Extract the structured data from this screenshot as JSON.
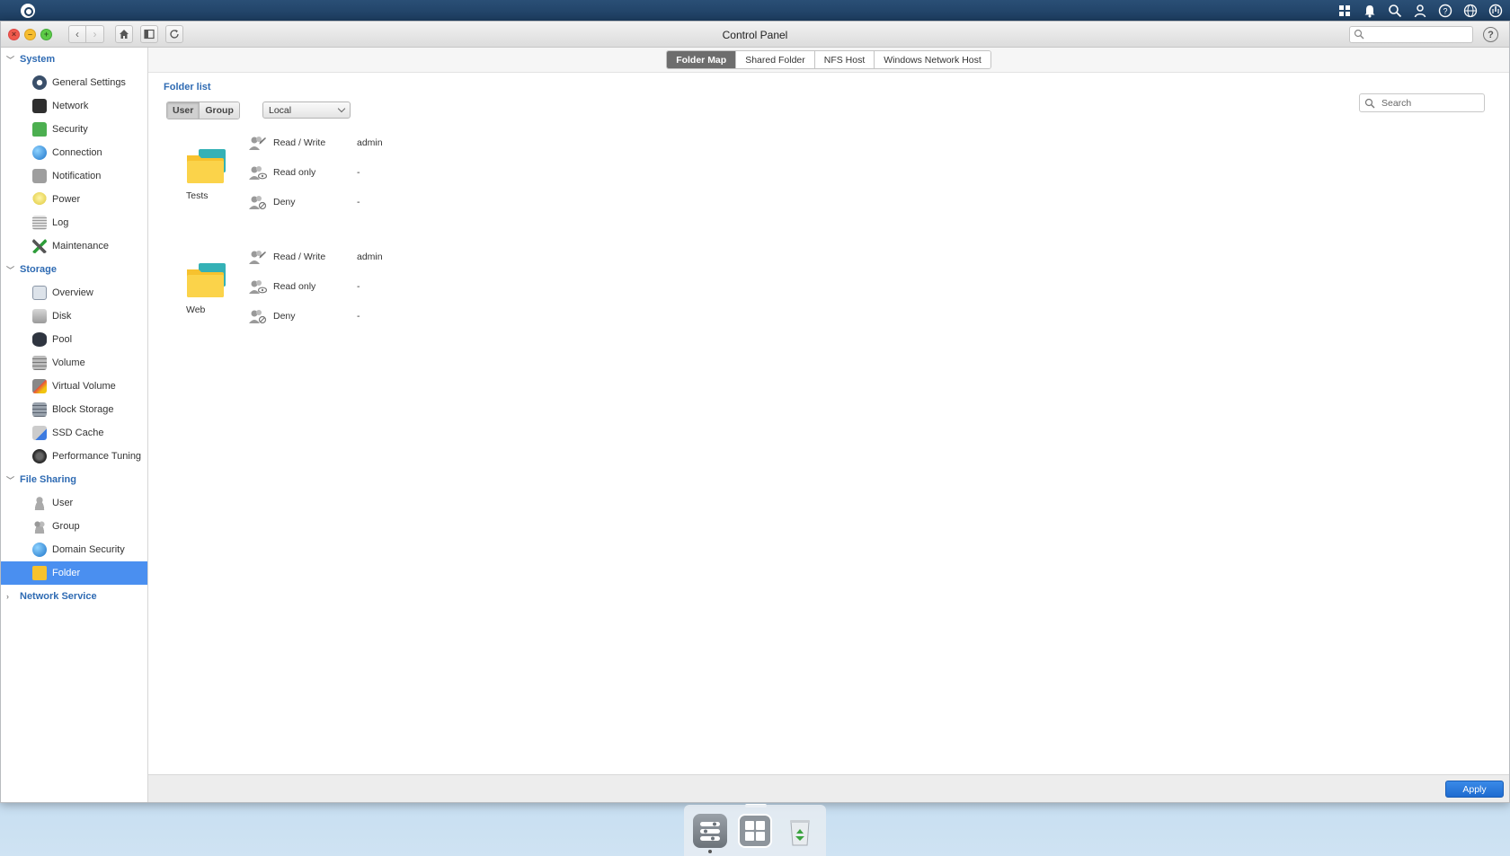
{
  "window": {
    "title": "Control Panel"
  },
  "sidebar": {
    "sections": [
      {
        "label": "System",
        "items": [
          "General Settings",
          "Network",
          "Security",
          "Connection",
          "Notification",
          "Power",
          "Log",
          "Maintenance"
        ]
      },
      {
        "label": "Storage",
        "items": [
          "Overview",
          "Disk",
          "Pool",
          "Volume",
          "Virtual Volume",
          "Block Storage",
          "SSD Cache",
          "Performance Tuning"
        ]
      },
      {
        "label": "File Sharing",
        "items": [
          "User",
          "Group",
          "Domain Security",
          "Folder"
        ]
      },
      {
        "label": "Network Service",
        "items": []
      }
    ],
    "active_item": "Folder"
  },
  "tabs": [
    "Folder Map",
    "Shared Folder",
    "NFS Host",
    "Windows Network Host"
  ],
  "active_tab": "Folder Map",
  "folder_list": {
    "title": "Folder list",
    "toggle": [
      "User",
      "Group"
    ],
    "toggle_active": "User",
    "scope": "Local",
    "search_placeholder": "Search",
    "folders": [
      {
        "name": "Tests",
        "permissions": [
          {
            "label": "Read / Write",
            "value": "admin"
          },
          {
            "label": "Read only",
            "value": "-"
          },
          {
            "label": "Deny",
            "value": "-"
          }
        ]
      },
      {
        "name": "Web",
        "permissions": [
          {
            "label": "Read / Write",
            "value": "admin"
          },
          {
            "label": "Read only",
            "value": "-"
          },
          {
            "label": "Deny",
            "value": "-"
          }
        ]
      }
    ]
  },
  "footer": {
    "apply_label": "Apply"
  },
  "colors": {
    "accent": "#4a8ff0",
    "section_header": "#2f6bb3",
    "folder_yellow": "#f7c22e",
    "folder_teal": "#34b1b6"
  }
}
